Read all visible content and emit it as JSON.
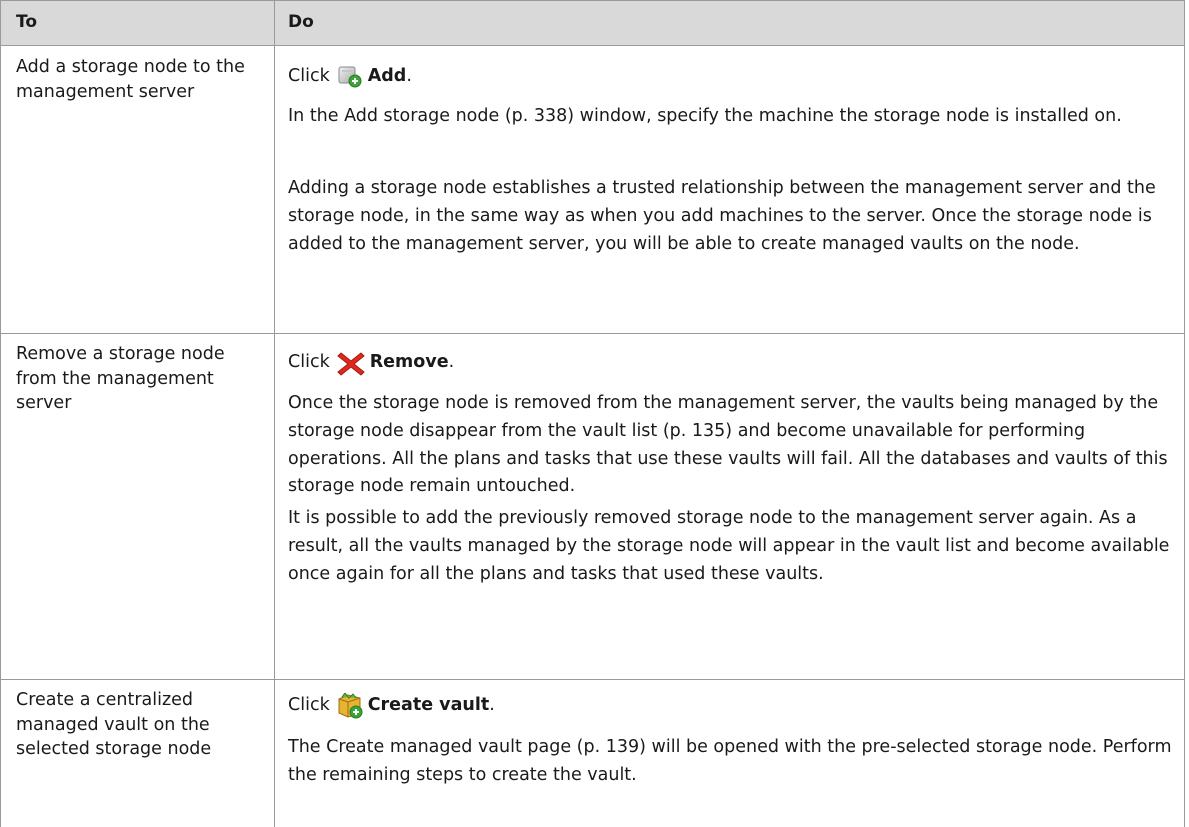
{
  "header": {
    "col_to": "To",
    "col_do": "Do"
  },
  "rows": [
    {
      "to": "Add a storage node to the management server",
      "click_prefix": "Click",
      "action_label": "Add",
      "action_suffix": ".",
      "icon": "add-storage-node-icon",
      "paragraphs": [
        "In the Add storage node (p. 338) window, specify the machine the storage node is installed on.",
        "Adding a storage node establishes a trusted relationship between the management server and the storage node, in the same way as when you add machines to the server. Once the storage node is added to the management server, you will be able to create managed vaults on the node."
      ]
    },
    {
      "to": "Remove a storage node from the management server",
      "click_prefix": "Click",
      "action_label": "Remove",
      "action_suffix": ".",
      "icon": "remove-x-icon",
      "paragraphs": [
        "Once the storage node is removed from the management server, the vaults being managed by the storage node disappear from the vault list (p. 135) and become unavailable for performing operations. All the plans and tasks that use these vaults will fail. All the databases and vaults of this storage node remain untouched.",
        "It is possible to add the previously removed storage node to the management server again. As a result, all the vaults managed by the storage node will appear in the vault list and become available once again for all the plans and tasks that used these vaults."
      ]
    },
    {
      "to": "Create a centralized managed vault on the selected storage node",
      "click_prefix": "Click",
      "action_label": "Create vault",
      "action_suffix": ".",
      "icon": "create-vault-icon",
      "paragraphs": [
        "The Create managed vault page (p. 139) will be opened with the pre-selected storage node. Perform the remaining steps to create the vault."
      ]
    }
  ],
  "colors": {
    "header_bg": "#d9d9d9",
    "border": "#9a9a9a"
  }
}
